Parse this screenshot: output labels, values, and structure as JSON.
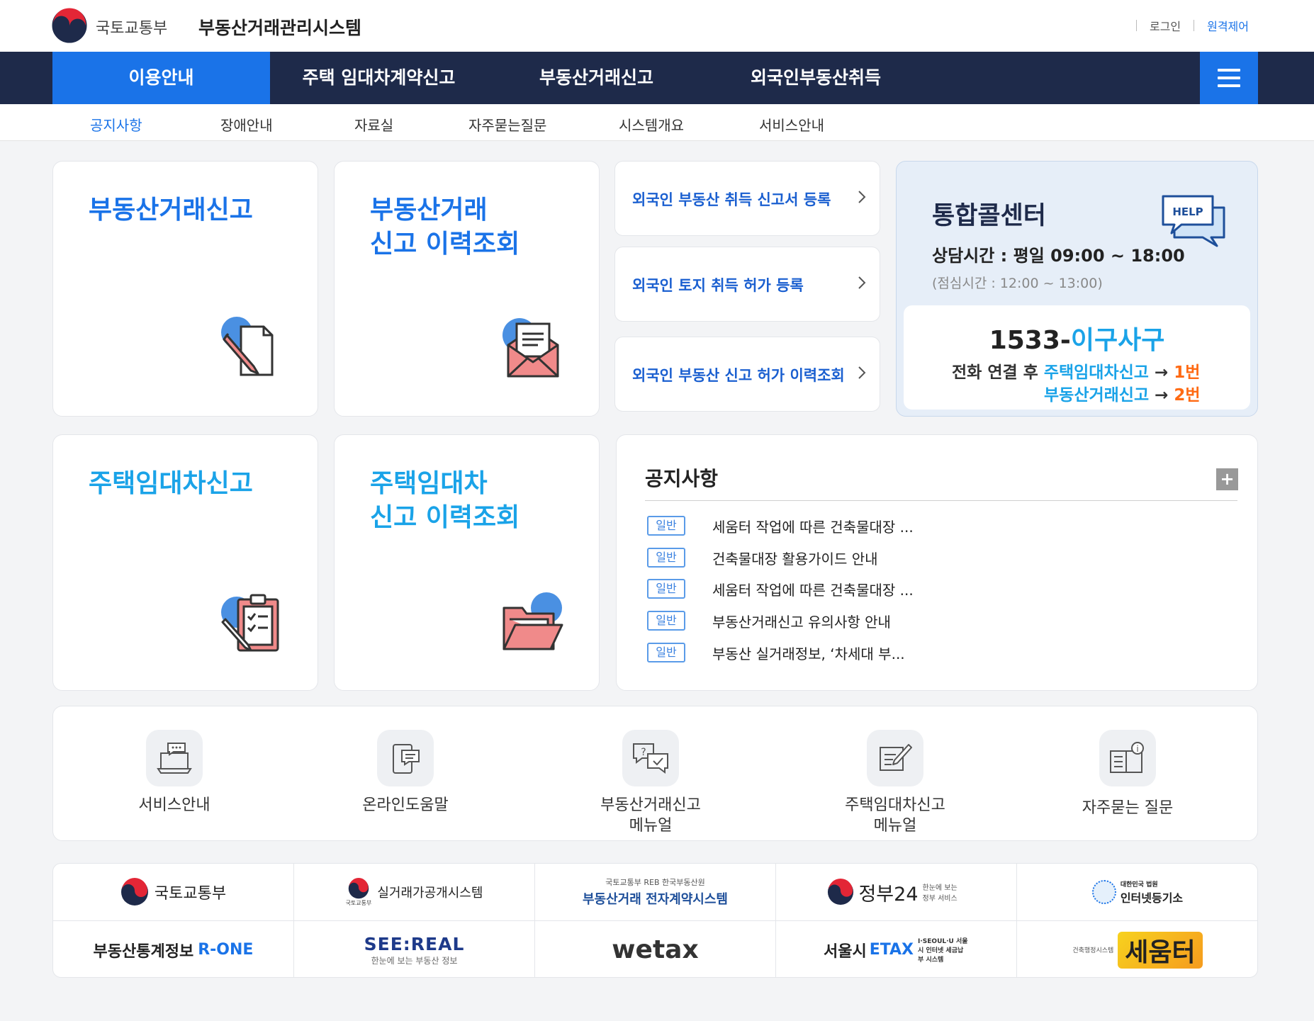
{
  "header": {
    "ministry_name": "국토교통부",
    "system_name": "부동산거래관리시스템",
    "login_label": "로그인",
    "remote_label": "원격제어"
  },
  "gnb": {
    "items": [
      {
        "label": "이용안내",
        "active": true
      },
      {
        "label": "주택 임대차계약신고",
        "active": false
      },
      {
        "label": "부동산거래신고",
        "active": false
      },
      {
        "label": "외국인부동산취득",
        "active": false
      }
    ],
    "menu_icon": "hamburger-icon"
  },
  "subnav": {
    "items": [
      {
        "label": "공지사항",
        "active": true
      },
      {
        "label": "장애안내",
        "active": false
      },
      {
        "label": "자료실",
        "active": false
      },
      {
        "label": "자주묻는질문",
        "active": false
      },
      {
        "label": "시스템개요",
        "active": false
      },
      {
        "label": "서비스안내",
        "active": false
      }
    ]
  },
  "cards": {
    "realestate_report": {
      "title": "부동산거래신고",
      "icon": "document-pen-icon"
    },
    "realestate_history": {
      "title": "부동산거래\n신고 이력조회",
      "icon": "mail-open-icon"
    },
    "lease_report": {
      "title": "주택임대차신고",
      "icon": "clipboard-icon"
    },
    "lease_history": {
      "title": "주택임대차\n신고 이력조회",
      "icon": "folder-open-icon"
    }
  },
  "foreign_links": [
    "외국인 부동산 취득 신고서 등록",
    "외국인 토지 취득 허가 등록",
    "외국인 부동산 신고 허가 이력조회"
  ],
  "callcenter": {
    "title": "통합콜센터",
    "hours": "상담시간 : 평일 09:00 ~ 18:00",
    "break_time": "(점심시간 : 12:00 ~ 13:00)",
    "help_icon_text": "HELP",
    "phone_prefix": "1533-",
    "phone_suffix": "이구사구",
    "line1_prefix": "전화 연결 후 ",
    "line1_service": "주택임대차신고",
    "line1_arrow": " → ",
    "line1_number": "1번",
    "line2_service": "부동산거래신고",
    "line2_arrow": " → ",
    "line2_number": "2번",
    "colors": {
      "accent": "#1aa3e8",
      "number": "#ff6a13"
    }
  },
  "notice": {
    "title": "공지사항",
    "more_label": "+",
    "items": [
      {
        "badge": "일반",
        "text": "세움터 작업에 따른 건축물대장 ..."
      },
      {
        "badge": "일반",
        "text": "건축물대장 활용가이드 안내"
      },
      {
        "badge": "일반",
        "text": "세움터 작업에 따른 건축물대장 ..."
      },
      {
        "badge": "일반",
        "text": "부동산거래신고 유의사항 안내"
      },
      {
        "badge": "일반",
        "text": "부동산 실거래정보, ‘차세대 부..."
      }
    ]
  },
  "quick_menu": [
    {
      "label": "서비스안내",
      "icon": "laptop-chat-icon"
    },
    {
      "label": "온라인도움말",
      "icon": "tablet-chat-icon"
    },
    {
      "label": "부동산거래신고\n메뉴얼",
      "icon": "question-chat-icon"
    },
    {
      "label": "주택임대차신고\n메뉴얼",
      "icon": "edit-note-icon"
    },
    {
      "label": "자주묻는 질문",
      "icon": "book-info-icon"
    }
  ],
  "banners": {
    "row1": [
      {
        "label": "국토교통부"
      },
      {
        "label": "실거래가공개시스템",
        "sub": "국토교통부"
      },
      {
        "top": "국토교통부  REB 한국부동산원",
        "label": "부동산거래 전자계약시스템"
      },
      {
        "label": "정부24",
        "sub": "한눈에 보는 정부 서비스"
      },
      {
        "top": "대한민국 법원",
        "label": "인터넷등기소"
      }
    ],
    "row2": [
      {
        "label": "부동산통계정보",
        "accent": "R-ONE"
      },
      {
        "label": "SEE:REAL",
        "sub": "한눈에 보는 부동산 정보"
      },
      {
        "label": "wetax"
      },
      {
        "label": "서울시",
        "accent": "ETAX",
        "sub": "I·SEOUL·U 서울시 인터넷 세금납부 시스템"
      },
      {
        "label": "세움터",
        "sub": "건축행정시스템"
      }
    ]
  },
  "colors": {
    "navy": "#1e2a4a",
    "primary": "#1a73e8",
    "cyan": "#1aa3e8",
    "background": "#f3f4f6"
  }
}
